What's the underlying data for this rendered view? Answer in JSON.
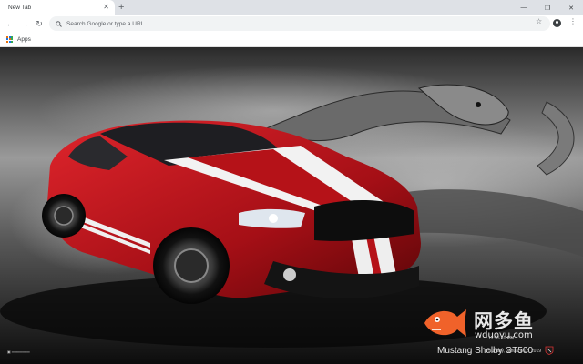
{
  "tab": {
    "title": "New Tab",
    "close": "✕"
  },
  "new_tab_glyph": "+",
  "window_controls": {
    "minimize": "—",
    "restore": "❐",
    "close": "✕"
  },
  "toolbar": {
    "back": "←",
    "forward": "→",
    "reload": "↻",
    "omnibox_placeholder": "Search Google or type a URL",
    "star": "☆",
    "menu": "⋮"
  },
  "bookmarks": {
    "apps_label": "Apps"
  },
  "wallpaper": {
    "brand_cn": "网多鱼",
    "brand_url": "wduoyu.com",
    "caption": "Mustang Shelby GT500",
    "caption_sub1": "12:55 10 PM",
    "caption_sub2": "Sunday, January 12, 2019"
  },
  "colors": {
    "car_red": "#c8141c",
    "stripe": "#ffffff",
    "logo_orange": "#f0622a"
  },
  "icons": {
    "search": "search-icon",
    "apps": "apps-grid-icon",
    "profile": "profile-icon"
  }
}
